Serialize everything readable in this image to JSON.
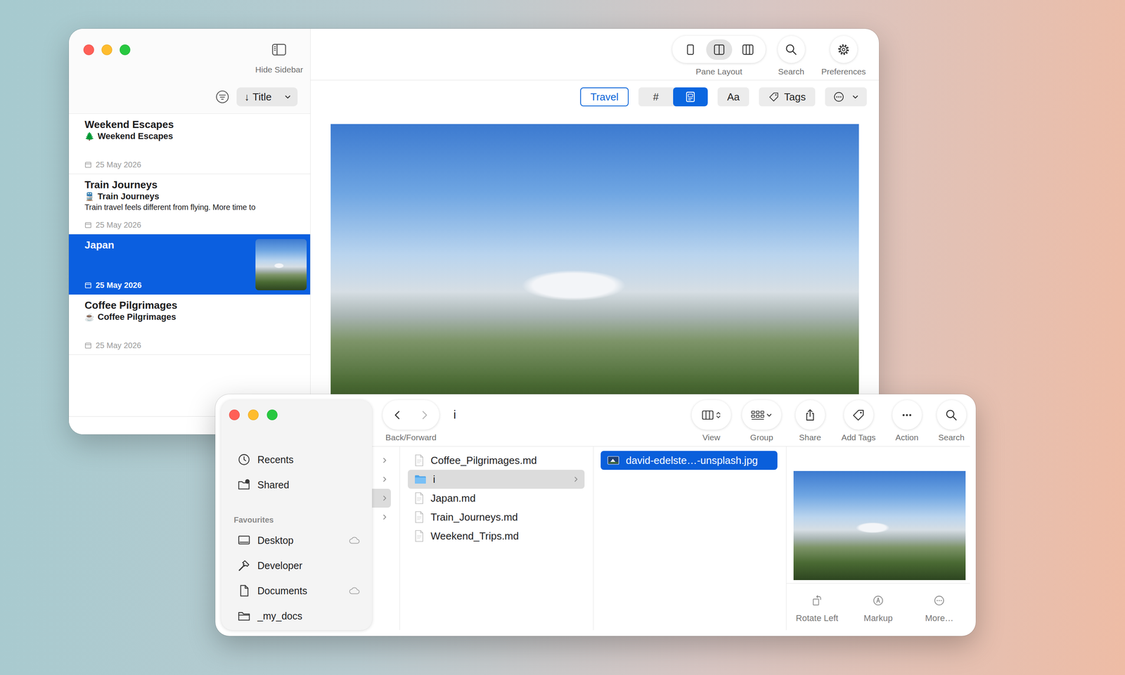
{
  "notes_window": {
    "toolbar": {
      "sidebar_toggle": "Hide Sidebar",
      "pane_layout": {
        "label": "Pane Layout",
        "options": [
          {
            "kind": "one",
            "selected": false
          },
          {
            "kind": "two",
            "selected": true
          },
          {
            "kind": "three",
            "selected": false
          }
        ]
      },
      "search": "Search",
      "preferences": "Preferences"
    },
    "sort": {
      "arrow": "↓",
      "label": "Title"
    },
    "format_bar": {
      "tag": "Travel",
      "segments": [
        {
          "kind": "text",
          "label": "#",
          "selected": false
        },
        {
          "kind": "image",
          "selected": true
        }
      ],
      "font_button": "Aa",
      "tags_button": "Tags"
    },
    "notes": [
      {
        "title": "Weekend Escapes",
        "icon": "🌲",
        "subtitle": "Weekend Escapes",
        "date": "25 May 2026",
        "selected": false,
        "thumbnail": false
      },
      {
        "title": "Train Journeys",
        "icon": "🚆",
        "subtitle": "Train Journeys",
        "preview": "Train travel feels different from flying. More time to",
        "date": "25 May 2026",
        "selected": false,
        "thumbnail": false
      },
      {
        "title": "Japan",
        "date": "25 May 2026",
        "selected": true,
        "thumbnail": true
      },
      {
        "title": "Coffee Pilgrimages",
        "icon": "☕",
        "subtitle": "Coffee Pilgrimages",
        "date": "25 May 2026",
        "selected": false,
        "thumbnail": false
      }
    ]
  },
  "finder_window": {
    "path_title": "i",
    "back_forward": {
      "label": "Back/Forward",
      "back_enabled": true,
      "forward_enabled": false
    },
    "toolbar_buttons": [
      {
        "kind": "view",
        "label": "View"
      },
      {
        "kind": "group",
        "label": "Group"
      },
      {
        "kind": "share",
        "label": "Share"
      },
      {
        "kind": "tag",
        "label": "Add Tags"
      },
      {
        "kind": "action",
        "label": "Action"
      },
      {
        "kind": "search",
        "label": "Search"
      }
    ],
    "sidebar": {
      "items": [
        {
          "kind": "recents",
          "label": "Recents",
          "cloud": false
        },
        {
          "kind": "shared",
          "label": "Shared",
          "cloud": false
        }
      ],
      "sections": [
        {
          "title": "Favourites",
          "items": [
            {
              "kind": "desktop",
              "label": "Desktop",
              "cloud": true
            },
            {
              "kind": "developer",
              "label": "Developer",
              "cloud": false
            },
            {
              "kind": "documents",
              "label": "Documents",
              "cloud": true
            },
            {
              "kind": "folder",
              "label": "_my_docs",
              "cloud": false
            }
          ]
        }
      ]
    },
    "columns": [
      {
        "active": false,
        "rows": [
          {
            "kind": "folder",
            "selected": false
          },
          {
            "kind": "folder",
            "selected": false
          },
          {
            "kind": "folder",
            "selected": true
          },
          {
            "kind": "folder",
            "selected": false
          }
        ]
      },
      {
        "active": false,
        "rows": [
          {
            "name": "Coffee_Pilgrimages.md",
            "kind": "file",
            "selected": false
          },
          {
            "name": "i",
            "kind": "folder",
            "selected": true
          },
          {
            "name": "Japan.md",
            "kind": "file",
            "selected": false
          },
          {
            "name": "Train_Journeys.md",
            "kind": "file",
            "selected": false
          },
          {
            "name": "Weekend_Trips.md",
            "kind": "file",
            "selected": false
          }
        ]
      },
      {
        "active": true,
        "rows": [
          {
            "name": "david-edelste…-unsplash.jpg",
            "kind": "image",
            "selected": true
          }
        ]
      }
    ],
    "preview": {
      "actions": [
        {
          "kind": "rotate",
          "label": "Rotate Left"
        },
        {
          "kind": "markup",
          "label": "Markup"
        },
        {
          "kind": "more",
          "label": "More…"
        }
      ]
    }
  }
}
